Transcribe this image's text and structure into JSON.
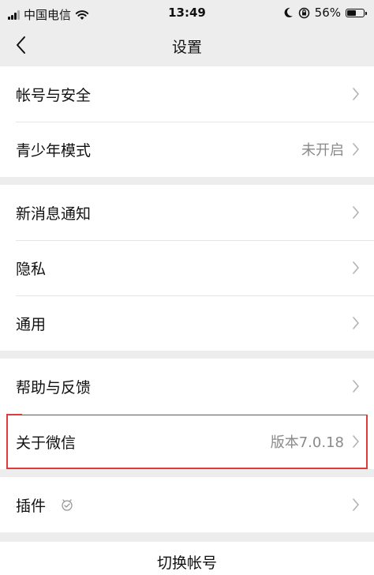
{
  "status_bar": {
    "carrier": "中国电信",
    "time": "13:49",
    "battery": "56%",
    "battery_level": 0.56
  },
  "nav": {
    "title": "设置",
    "back_icon": "chevron-left-icon"
  },
  "groups": [
    {
      "items": [
        {
          "label": "帐号与安全",
          "value": ""
        },
        {
          "label": "青少年模式",
          "value": "未开启"
        }
      ]
    },
    {
      "items": [
        {
          "label": "新消息通知",
          "value": ""
        },
        {
          "label": "隐私",
          "value": ""
        },
        {
          "label": "通用",
          "value": ""
        }
      ]
    },
    {
      "items": [
        {
          "label": "帮助与反馈",
          "value": ""
        },
        {
          "label": "关于微信",
          "value": "版本7.0.18",
          "highlighted": true
        }
      ]
    },
    {
      "items": [
        {
          "label": "插件",
          "value": "",
          "icon": "plugin-icon"
        }
      ]
    }
  ],
  "bottom": {
    "switch_account": "切换帐号"
  },
  "colors": {
    "background": "#ededed",
    "row_background": "#ffffff",
    "highlight_border": "#e03a3a",
    "secondary_text": "#8a8a8a"
  }
}
